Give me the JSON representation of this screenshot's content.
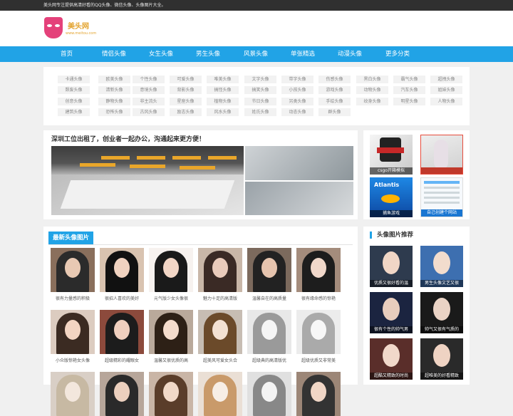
{
  "topbar": {
    "text": "美头网专注提供高清好看的QQ头像、微信头像、头像图片大全。"
  },
  "logo": {
    "name": "美头网",
    "url": "www.meitou.com"
  },
  "nav": {
    "items": [
      "首页",
      "情侣头像",
      "女生头像",
      "男生头像",
      "风景头像",
      "单张精选",
      "动漫头像",
      "更多分类"
    ]
  },
  "tags": [
    [
      "卡通头像",
      "欧美头像",
      "个性头像",
      "可爱头像",
      "唯美头像",
      "文字头像",
      "带字头像",
      "伤感头像",
      "黑白头像",
      "霸气头像",
      "超拽头像"
    ],
    [
      "颓废头像",
      "清新头像",
      "意境头像",
      "背影头像",
      "搞怪头像",
      "搞笑头像",
      "小孩头像",
      "游戏头像",
      "动物头像",
      "汽车头像",
      "姐妹头像"
    ],
    [
      "创意头像",
      "静物头像",
      "非主流头",
      "星座头像",
      "植物头像",
      "节日头像",
      "另类头像",
      "手绘头像",
      "纹身头像",
      "明星头像",
      "人物头像"
    ],
    [
      "建筑头像",
      "恐怖头像",
      "古风头像",
      "励志头像",
      "风水头像",
      "姓氏头像",
      "动态头像",
      "群头像"
    ]
  ],
  "promo": {
    "title": "深圳工位出租了，创业者一起办公，沟通起来更方便！"
  },
  "side_ads": [
    "csgo开箱模拟",
    "",
    "捕鱼游戏",
    "自己创建个网站"
  ],
  "latest": {
    "title": "最新头像图片",
    "items": [
      "很有力量感的积极",
      "很招人喜欢的美好",
      "元气版少女头像很",
      "魅力十足的高清版",
      "温馨自在的高质量",
      "很有缘命感的惊艳",
      "小众版惊艳女头像",
      "超级精彩的耀眼女",
      "温馨又很优质的高",
      "超美风可爱女头合",
      "超级典的高清版优",
      "超级优质又非常美",
      "",
      "",
      "",
      "",
      "",
      ""
    ]
  },
  "recommend": {
    "title": "头像图片推荐",
    "items": [
      "优质又很好看的温",
      "男生头像文艺又很",
      "很有个性的帅气男",
      "帅气又很有气质的",
      "超酷又精致的时尚",
      "超唯美的好看精致"
    ]
  },
  "colors": {
    "accent": "#21a3e6",
    "topbar": "#303030",
    "logo": "#e4417a"
  }
}
